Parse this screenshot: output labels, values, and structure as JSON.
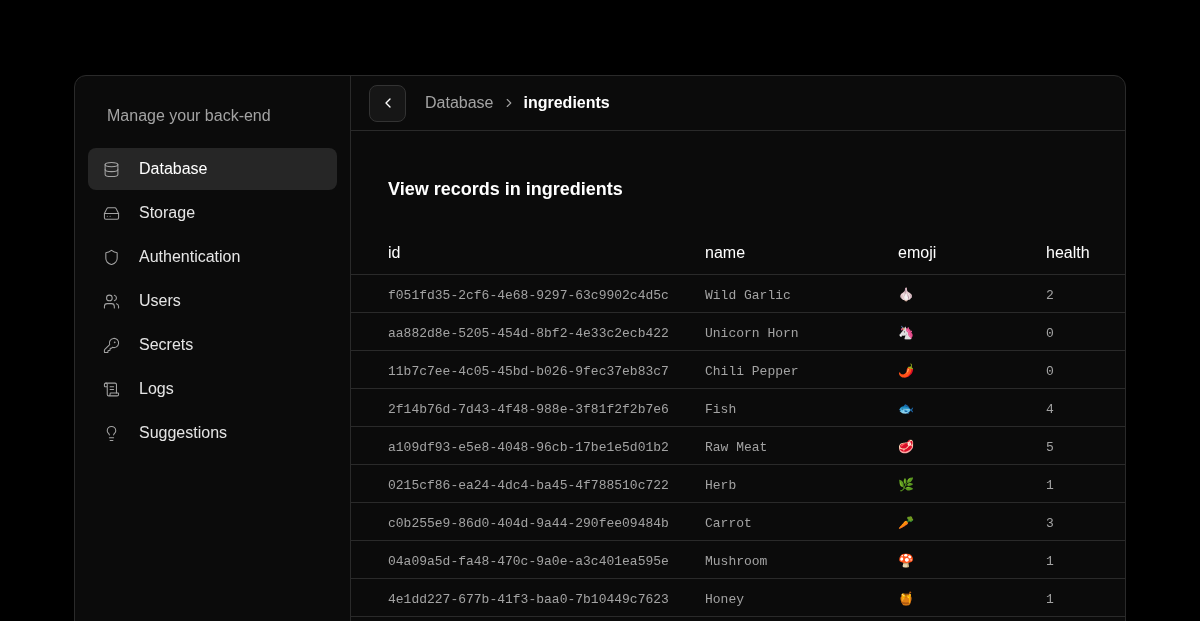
{
  "sidebar": {
    "title": "Manage your back-end",
    "items": [
      {
        "label": "Database",
        "selected": true
      },
      {
        "label": "Storage",
        "selected": false
      },
      {
        "label": "Authentication",
        "selected": false
      },
      {
        "label": "Users",
        "selected": false
      },
      {
        "label": "Secrets",
        "selected": false
      },
      {
        "label": "Logs",
        "selected": false
      },
      {
        "label": "Suggestions",
        "selected": false
      }
    ]
  },
  "breadcrumb": [
    "Database",
    "ingredients"
  ],
  "heading": "View records in ingredients",
  "table": {
    "columns": [
      "id",
      "name",
      "emoji",
      "health"
    ],
    "rows": [
      [
        "f051fd35-2cf6-4e68-9297-63c9902c4d5c",
        "Wild Garlic",
        "🧄",
        "2"
      ],
      [
        "aa882d8e-5205-454d-8bf2-4e33c2ecb422",
        "Unicorn Horn",
        "🦄",
        "0"
      ],
      [
        "11b7c7ee-4c05-45bd-b026-9fec37eb83c7",
        "Chili Pepper",
        "🌶️",
        "0"
      ],
      [
        "2f14b76d-7d43-4f48-988e-3f81f2f2b7e6",
        "Fish",
        "🐟",
        "4"
      ],
      [
        "a109df93-e5e8-4048-96cb-17be1e5d01b2",
        "Raw Meat",
        "🥩",
        "5"
      ],
      [
        "0215cf86-ea24-4dc4-ba45-4f788510c722",
        "Herb",
        "🌿",
        "1"
      ],
      [
        "c0b255e9-86d0-404d-9a44-290fee09484b",
        "Carrot",
        "🥕",
        "3"
      ],
      [
        "04a09a5d-fa48-470c-9a0e-a3c401ea595e",
        "Mushroom",
        "🍄",
        "1"
      ],
      [
        "4e1dd227-677b-41f3-baa0-7b10449c7623",
        "Honey",
        "🍯",
        "1"
      ]
    ]
  }
}
